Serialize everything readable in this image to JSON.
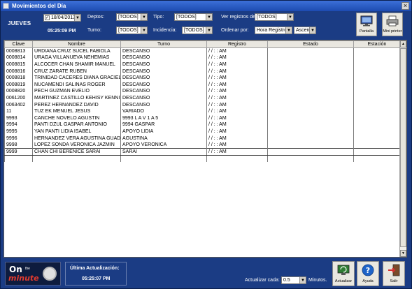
{
  "window": {
    "title": "Movimientos del Día"
  },
  "header": {
    "day": "JUEVES",
    "date": "18/04/2013",
    "clock": "05:25:09 PM",
    "filters": {
      "deptos_label": "Deptos:",
      "deptos_value": "[TODOS]",
      "tipo_label": "Tipo:",
      "tipo_value": "[TODOS]",
      "turno_label": "Turno:",
      "turno_value": "[TODOS]",
      "incidencia_label": "Incidencia:",
      "incidencia_value": "[TODOS]",
      "ver_label": "Ver registros de:",
      "ver_value": "[TODOS]",
      "ordenar_label": "Ordenar por:",
      "ordenar_value": "Hora Registro",
      "orden_dir_value": "Ascen"
    },
    "buttons": {
      "pantalla": "Pantalla",
      "mini_printer": "Mini printer"
    }
  },
  "grid": {
    "columns": [
      "Clave",
      "Nombre",
      "Turno",
      "Registro",
      "Estado",
      "Estación"
    ],
    "rows": [
      {
        "clave": "0008813",
        "nombre": "URDIANA CRUZ SUCEL FABIOLA",
        "turno": "DESCANSO",
        "registro": "/ /     :  :  AM",
        "estado": "",
        "estacion": ""
      },
      {
        "clave": "0008814",
        "nombre": "URAGA VILLANUEVA NEHEMIAS",
        "turno": "DESCANSO",
        "registro": "/ /     :  :  AM",
        "estado": "",
        "estacion": ""
      },
      {
        "clave": "0008815",
        "nombre": "ALCOCER CHAN SHAMIR MANUEL",
        "turno": "DESCANSO",
        "registro": "/ /     :  :  AM",
        "estado": "",
        "estacion": ""
      },
      {
        "clave": "0008816",
        "nombre": "CRUZ ZARATE RUBEN",
        "turno": "DESCANSO",
        "registro": "/ /     :  :  AM",
        "estado": "",
        "estacion": ""
      },
      {
        "clave": "0008818",
        "nombre": "TRINIDAD CACERES DIANA GRACIELA",
        "turno": "DESCANSO",
        "registro": "/ /     :  :  AM",
        "estado": "",
        "estacion": ""
      },
      {
        "clave": "0008819",
        "nombre": "NUCAMENDI SALINAS ROGER",
        "turno": "DESCANSO",
        "registro": "/ /     :  :  AM",
        "estado": "",
        "estacion": ""
      },
      {
        "clave": "0008820",
        "nombre": "PECH GUZMAN EVELIO",
        "turno": "DESCANSO",
        "registro": "/ /     :  :  AM",
        "estado": "",
        "estacion": ""
      },
      {
        "clave": "0061200",
        "nombre": "MARTINEZ CASTILLO KEHISY KENNI",
        "turno": "DESCANSO",
        "registro": "/ /     :  :  AM",
        "estado": "",
        "estacion": ""
      },
      {
        "clave": "0063402",
        "nombre": "PEREZ HERNANDEZ DAVID",
        "turno": "DESCANSO",
        "registro": "/ /     :  :  AM",
        "estado": "",
        "estacion": ""
      },
      {
        "clave": "11",
        "nombre": "TUZ EK MENUEL JESUS",
        "turno": "VARIADO",
        "registro": "/ /     :  :  AM",
        "estado": "",
        "estacion": ""
      },
      {
        "clave": "9993",
        "nombre": "CANCHE NOVELO AGUSTIN",
        "turno": "9993  L A V 1 A 5",
        "registro": "/ /     :  :  AM",
        "estado": "",
        "estacion": ""
      },
      {
        "clave": "9994",
        "nombre": "PANTI DZUL GASPAR ANTONIO",
        "turno": "9994  GASPAR",
        "registro": "/ /     :  :  AM",
        "estado": "",
        "estacion": ""
      },
      {
        "clave": "9995",
        "nombre": "YAN PANTI LIDIA ISABEL",
        "turno": "APOYO LIDIA",
        "registro": "/ /     :  :  AM",
        "estado": "",
        "estacion": ""
      },
      {
        "clave": "9996",
        "nombre": "HERNANDEZ VERA AGUSTINA GUADAL",
        "turno": "AGUSTINA",
        "registro": "/ /     :  :  AM",
        "estado": "",
        "estacion": ""
      },
      {
        "clave": "9998",
        "nombre": "LOPEZ SONDA VERONICA JAZMIN",
        "turno": "APOYO VERONICA",
        "registro": "/ /     :  :  AM",
        "estado": "",
        "estacion": ""
      },
      {
        "clave": "9999",
        "nombre": "CHAN CHI BERENICE SARAI",
        "turno": "SARAI",
        "registro": "/ /     :  :  AM",
        "estado": "",
        "estacion": ""
      }
    ]
  },
  "footer": {
    "logo_on": "On",
    "logo_the": "the",
    "logo_minute": "minute",
    "last_update_label": "Última Actualización:",
    "last_update_time": "05:25:07 PM",
    "actualizar_cada_label": "Actualizar cada:",
    "interval_value": "0.5",
    "minutos_label": "Minutos.",
    "buttons": {
      "actualizar": "Actualizar",
      "ayuda": "Ayuda",
      "salir": "Salir"
    }
  }
}
